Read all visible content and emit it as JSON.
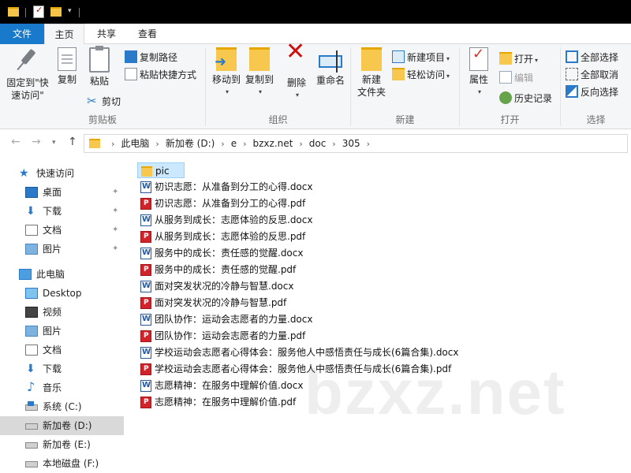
{
  "tabs": {
    "file": "文件",
    "home": "主页",
    "share": "共享",
    "view": "查看"
  },
  "ribbon": {
    "clipboard": {
      "group_label": "剪贴板",
      "pin_label_1": "固定到\"快",
      "pin_label_2": "速访问\"",
      "copy": "复制",
      "paste": "粘贴",
      "copy_path": "复制路径",
      "paste_shortcut": "粘贴快捷方式",
      "cut": "剪切"
    },
    "organize": {
      "group_label": "组织",
      "move_to": "移动到",
      "copy_to": "复制到",
      "delete": "删除",
      "rename": "重命名"
    },
    "new": {
      "group_label": "新建",
      "new_folder_1": "新建",
      "new_folder_2": "文件夹",
      "new_item": "新建项目",
      "easy_access": "轻松访问"
    },
    "open": {
      "group_label": "打开",
      "properties": "属性",
      "open": "打开",
      "edit": "编辑",
      "history": "历史记录"
    },
    "select": {
      "group_label": "选择",
      "select_all": "全部选择",
      "select_none": "全部取消",
      "invert": "反向选择"
    }
  },
  "address": {
    "crumbs": [
      "此电脑",
      "新加卷 (D:)",
      "e",
      "bzxz.net",
      "doc",
      "305"
    ]
  },
  "sidebar": {
    "quick_access": "快速访问",
    "qa_items": [
      "桌面",
      "下载",
      "文档",
      "图片"
    ],
    "this_pc": "此电脑",
    "pc_items": [
      "Desktop",
      "视频",
      "图片",
      "文档",
      "下载",
      "音乐",
      "系统 (C:)",
      "新加卷 (D:)",
      "新加卷 (E:)",
      "本地磁盘 (F:)"
    ]
  },
  "files": [
    {
      "name": "pic",
      "type": "folder"
    },
    {
      "name": "初识志愿：从准备到分工的心得.docx",
      "type": "docx"
    },
    {
      "name": "初识志愿：从准备到分工的心得.pdf",
      "type": "pdf"
    },
    {
      "name": "从服务到成长：志愿体验的反思.docx",
      "type": "docx"
    },
    {
      "name": "从服务到成长：志愿体验的反思.pdf",
      "type": "pdf"
    },
    {
      "name": "服务中的成长：责任感的觉醒.docx",
      "type": "docx"
    },
    {
      "name": "服务中的成长：责任感的觉醒.pdf",
      "type": "pdf"
    },
    {
      "name": "面对突发状况的冷静与智慧.docx",
      "type": "docx"
    },
    {
      "name": "面对突发状况的冷静与智慧.pdf",
      "type": "pdf"
    },
    {
      "name": "团队协作：运动会志愿者的力量.docx",
      "type": "docx"
    },
    {
      "name": "团队协作：运动会志愿者的力量.pdf",
      "type": "pdf"
    },
    {
      "name": "学校运动会志愿者心得体会：服务他人中感悟责任与成长(6篇合集).docx",
      "type": "docx"
    },
    {
      "name": "学校运动会志愿者心得体会：服务他人中感悟责任与成长(6篇合集).pdf",
      "type": "pdf"
    },
    {
      "name": "志愿精神：在服务中理解价值.docx",
      "type": "docx"
    },
    {
      "name": "志愿精神：在服务中理解价值.pdf",
      "type": "pdf"
    }
  ],
  "watermark": "bzxz.net"
}
